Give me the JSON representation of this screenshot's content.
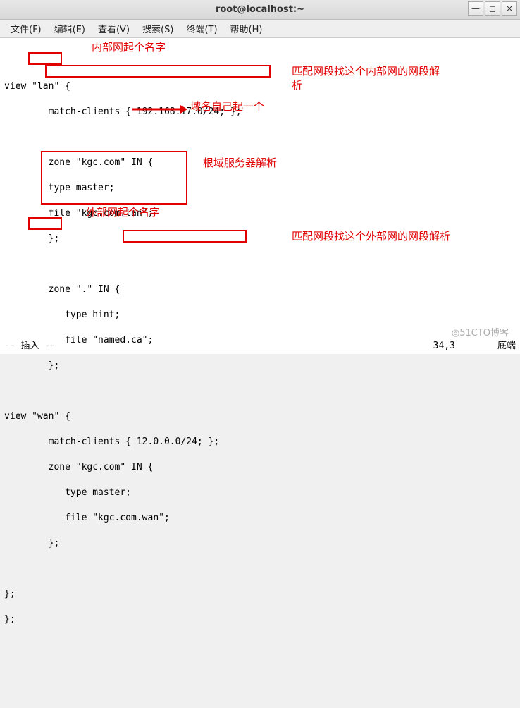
{
  "window": {
    "title": "root@localhost:~",
    "min": "—",
    "max": "◻",
    "close": "×"
  },
  "menu": {
    "file": "文件(F)",
    "edit": "编辑(E)",
    "view": "查看(V)",
    "search": "搜索(S)",
    "terminal": "终端(T)",
    "help": "帮助(H)"
  },
  "code": {
    "l1": "view \"lan\" {",
    "l2": "        match-clients { 192.168.17.0/24; };",
    "l3": "",
    "l4": "        zone \"kgc.com\" IN {",
    "l5": "        type master;",
    "l6": "        file \"kgc.com.lan\";",
    "l7": "        };",
    "l8": "",
    "l9": "        zone \".\" IN {",
    "l10": "           type hint;",
    "l11": "           file \"named.ca\";",
    "l12": "        };",
    "l13": "",
    "l14": "view \"wan\" {",
    "l15": "        match-clients { 12.0.0.0/24; };",
    "l16": "        zone \"kgc.com\" IN {",
    "l17": "           type master;",
    "l18": "           file \"kgc.com.wan\";",
    "l19": "        };",
    "l20": "",
    "l21": "};",
    "l22": "};"
  },
  "annotations": {
    "a1": "内部网起个名字",
    "a2": "匹配网段找这个内部网的网段解",
    "a2b": "析",
    "a3": "域名自己起一个",
    "a4": "根域服务器解析",
    "a5": "外部网起个名字",
    "a6": "匹配网段找这个外部网的网段解析"
  },
  "status": {
    "mode": "-- 插入 --",
    "pos": "34,3",
    "loc": "底端"
  },
  "watermark": "◎51CTO博客"
}
